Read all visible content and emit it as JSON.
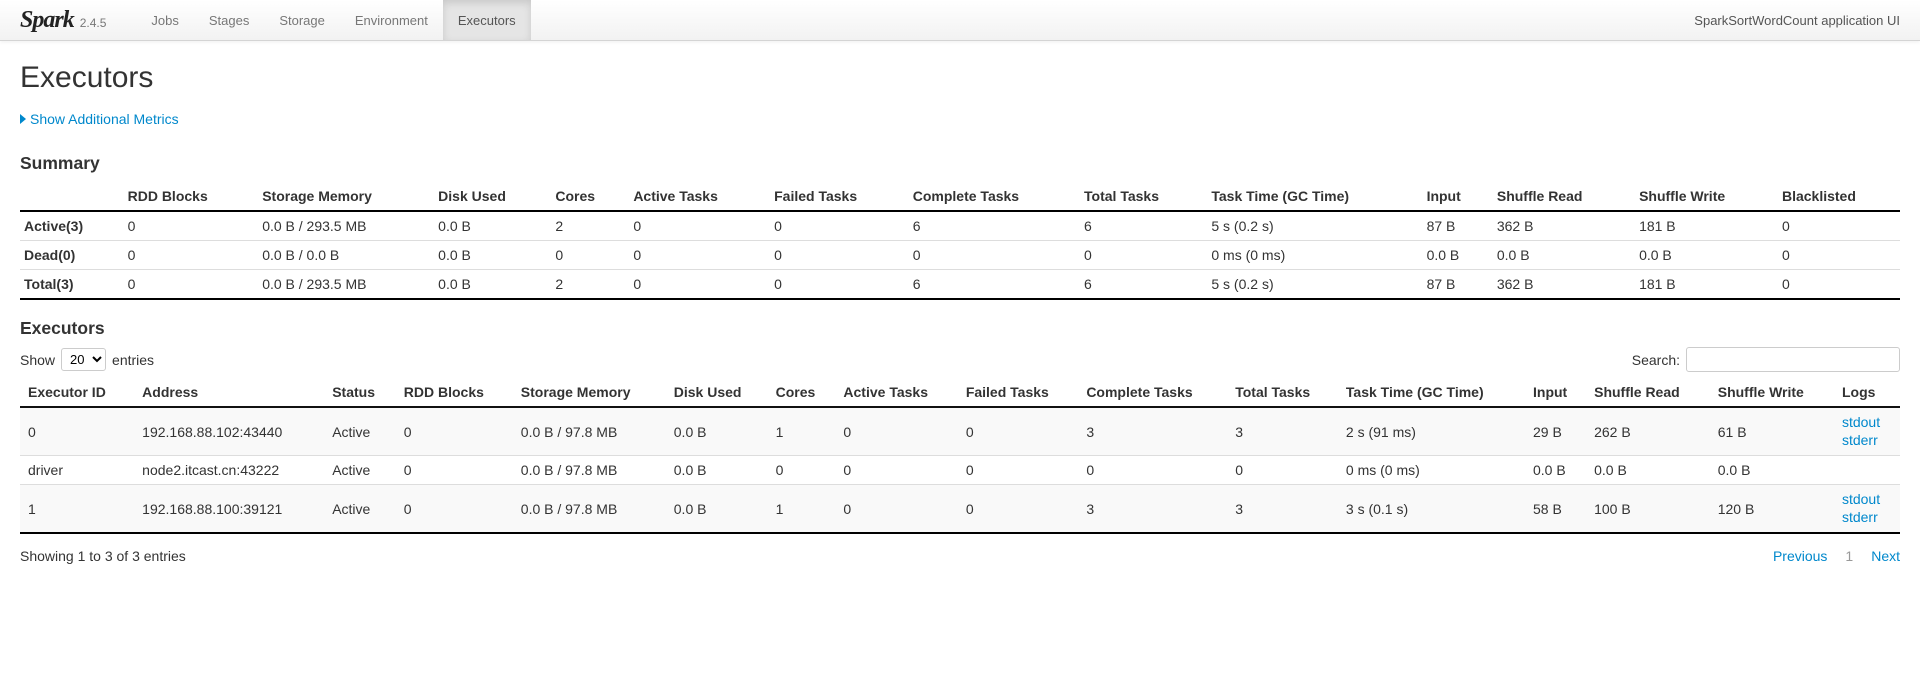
{
  "brand": {
    "name": "Spark",
    "version": "2.4.5"
  },
  "nav": {
    "tabs": [
      {
        "label": "Jobs"
      },
      {
        "label": "Stages"
      },
      {
        "label": "Storage"
      },
      {
        "label": "Environment"
      },
      {
        "label": "Executors",
        "active": true
      }
    ],
    "app_title": "SparkSortWordCount application UI"
  },
  "page_title": "Executors",
  "metrics_toggle": "Show Additional Metrics",
  "summary": {
    "heading": "Summary",
    "headers": [
      "",
      "RDD Blocks",
      "Storage Memory",
      "Disk Used",
      "Cores",
      "Active Tasks",
      "Failed Tasks",
      "Complete Tasks",
      "Total Tasks",
      "Task Time (GC Time)",
      "Input",
      "Shuffle Read",
      "Shuffle Write",
      "Blacklisted"
    ],
    "rows": [
      {
        "label": "Active(3)",
        "cells": [
          "0",
          "0.0 B / 293.5 MB",
          "0.0 B",
          "2",
          "0",
          "0",
          "6",
          "6",
          "5 s (0.2 s)",
          "87 B",
          "362 B",
          "181 B",
          "0"
        ]
      },
      {
        "label": "Dead(0)",
        "cells": [
          "0",
          "0.0 B / 0.0 B",
          "0.0 B",
          "0",
          "0",
          "0",
          "0",
          "0",
          "0 ms (0 ms)",
          "0.0 B",
          "0.0 B",
          "0.0 B",
          "0"
        ]
      },
      {
        "label": "Total(3)",
        "cells": [
          "0",
          "0.0 B / 293.5 MB",
          "0.0 B",
          "2",
          "0",
          "0",
          "6",
          "6",
          "5 s (0.2 s)",
          "87 B",
          "362 B",
          "181 B",
          "0"
        ]
      }
    ]
  },
  "executors": {
    "heading": "Executors",
    "show_label": "Show",
    "entries_label": "entries",
    "page_size": "20",
    "search_label": "Search:",
    "search_value": "",
    "headers": [
      "Executor ID",
      "Address",
      "Status",
      "RDD Blocks",
      "Storage Memory",
      "Disk Used",
      "Cores",
      "Active Tasks",
      "Failed Tasks",
      "Complete Tasks",
      "Total Tasks",
      "Task Time (GC Time)",
      "Input",
      "Shuffle Read",
      "Shuffle Write",
      "Logs"
    ],
    "rows": [
      {
        "cells": [
          "0",
          "192.168.88.102:43440",
          "Active",
          "0",
          "0.0 B / 97.8 MB",
          "0.0 B",
          "1",
          "0",
          "0",
          "3",
          "3",
          "2 s (91 ms)",
          "29 B",
          "262 B",
          "61 B"
        ],
        "logs": [
          "stdout",
          "stderr"
        ]
      },
      {
        "cells": [
          "driver",
          "node2.itcast.cn:43222",
          "Active",
          "0",
          "0.0 B / 97.8 MB",
          "0.0 B",
          "0",
          "0",
          "0",
          "0",
          "0",
          "0 ms (0 ms)",
          "0.0 B",
          "0.0 B",
          "0.0 B"
        ],
        "logs": []
      },
      {
        "cells": [
          "1",
          "192.168.88.100:39121",
          "Active",
          "0",
          "0.0 B / 97.8 MB",
          "0.0 B",
          "1",
          "0",
          "0",
          "3",
          "3",
          "3 s (0.1 s)",
          "58 B",
          "100 B",
          "120 B"
        ],
        "logs": [
          "stdout",
          "stderr"
        ]
      }
    ],
    "info": "Showing 1 to 3 of 3 entries",
    "paginate": {
      "previous": "Previous",
      "next": "Next",
      "current": "1"
    }
  }
}
